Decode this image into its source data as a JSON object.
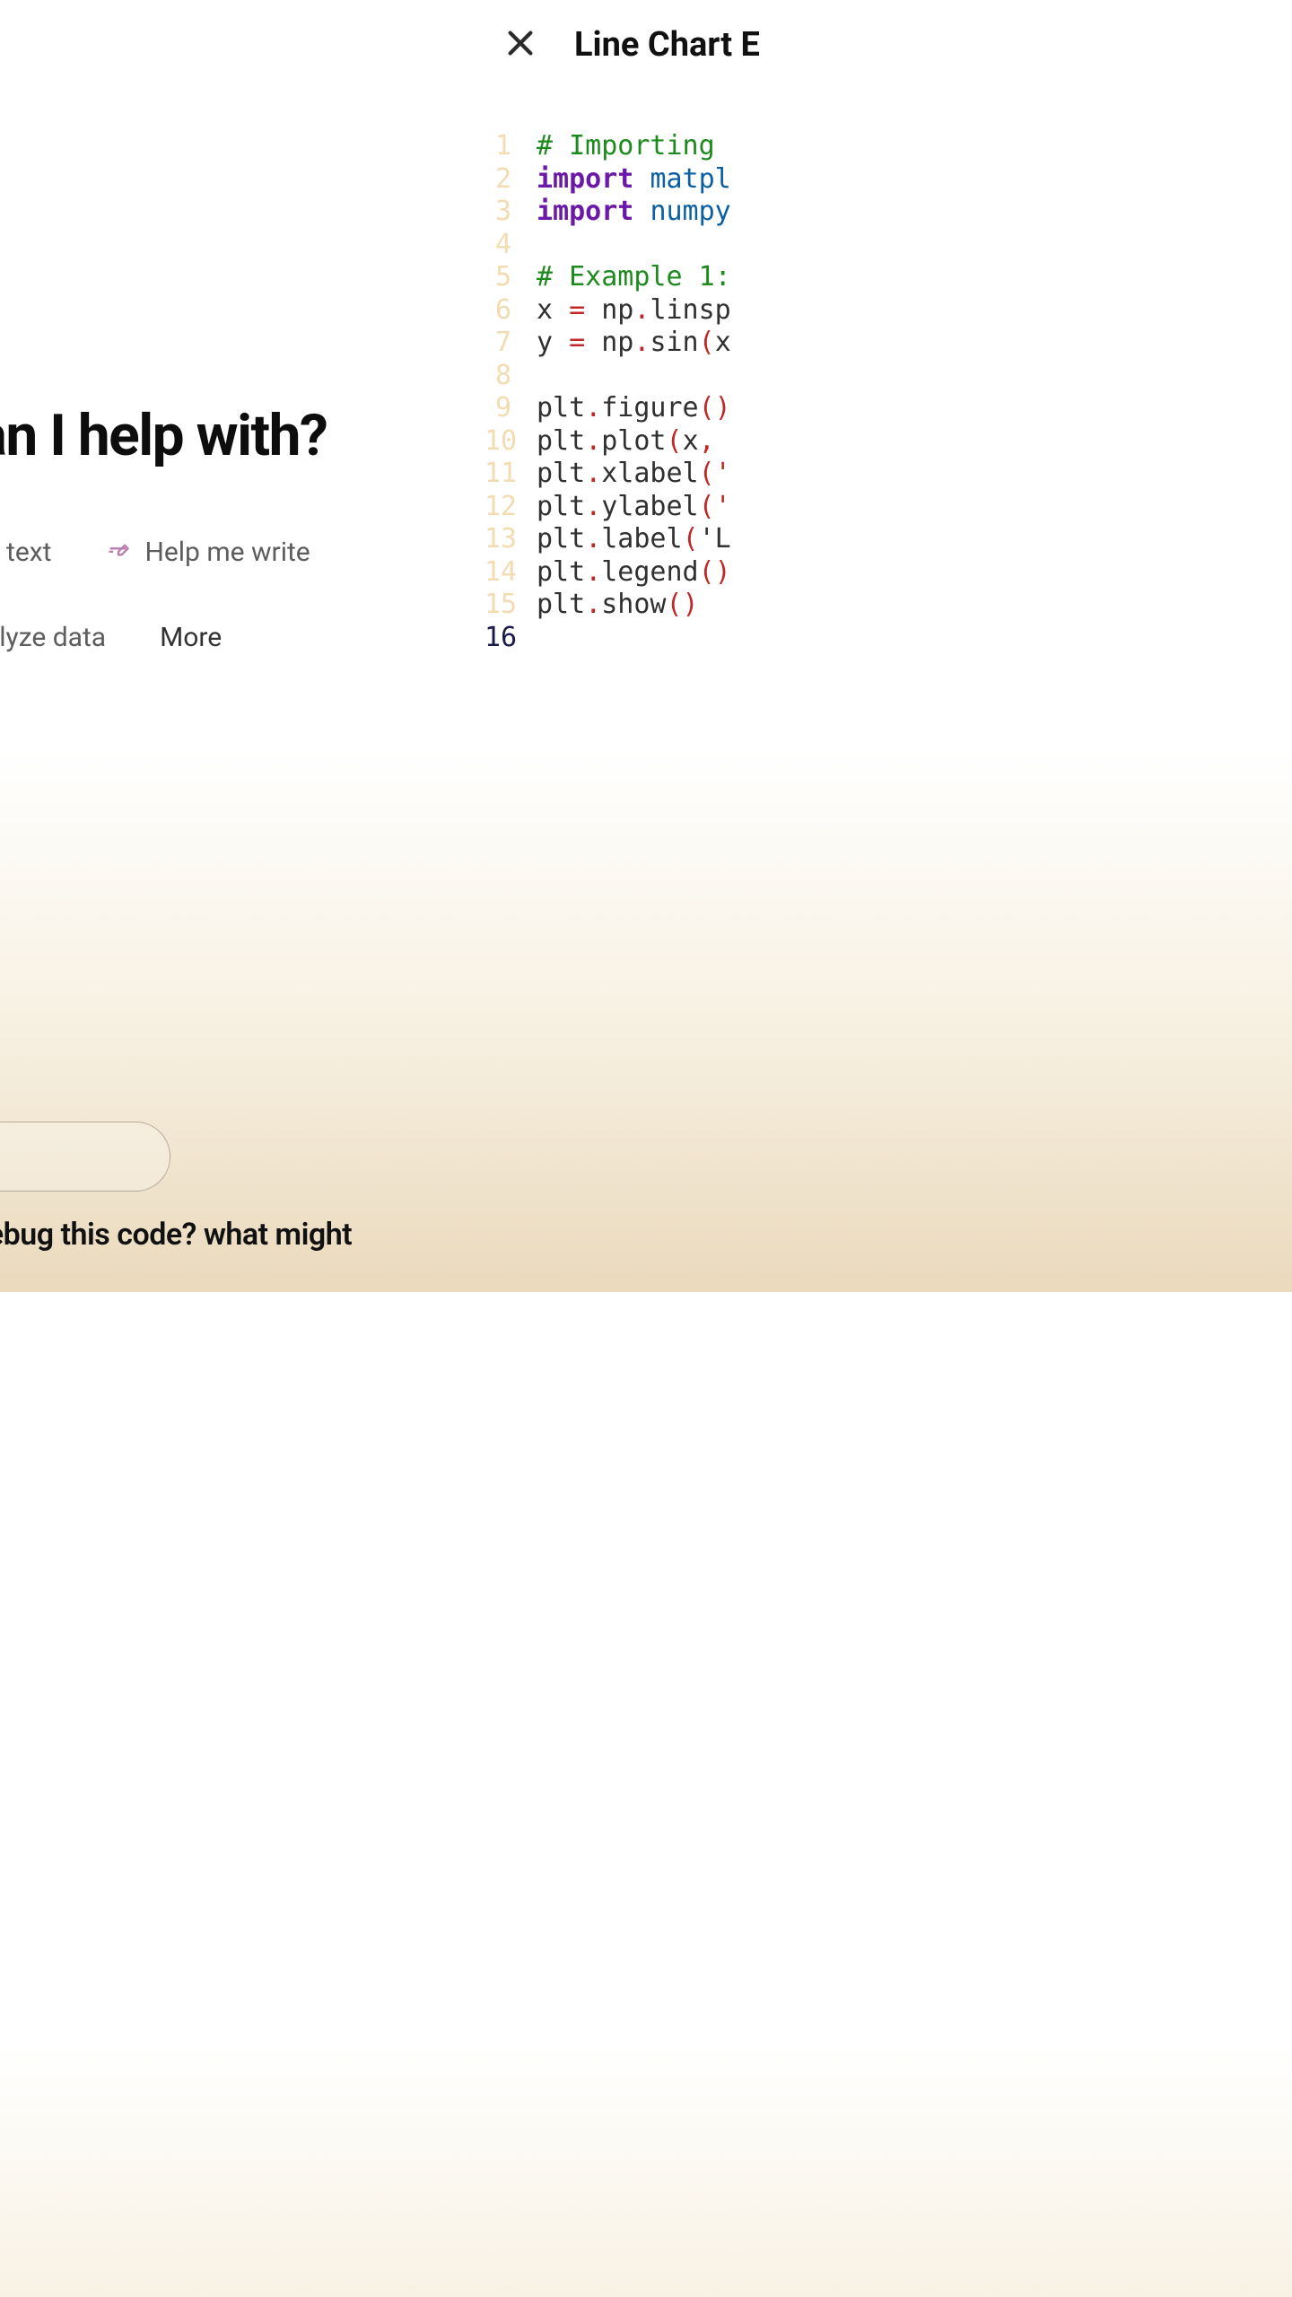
{
  "left": {
    "headline": "What can I help with?",
    "chips1": [
      {
        "id": "summarize",
        "label": "Summarize text"
      },
      {
        "id": "write",
        "label": "Help me write"
      }
    ],
    "chips2": [
      {
        "id": "analyze",
        "label": "Analyze data"
      },
      {
        "id": "more",
        "label": "More"
      }
    ],
    "partial_prompt": "Can you debug this code? what might"
  },
  "panel": {
    "title": "Line Chart E",
    "close_glyph": "×",
    "lines": [
      {
        "n": "1",
        "tokens": [
          [
            "cm",
            "# Importing "
          ]
        ]
      },
      {
        "n": "2",
        "tokens": [
          [
            "kw",
            "import"
          ],
          [
            "",
            " "
          ],
          [
            "mod",
            "matpl"
          ]
        ]
      },
      {
        "n": "3",
        "tokens": [
          [
            "kw",
            "import"
          ],
          [
            "",
            " "
          ],
          [
            "mod",
            "numpy"
          ]
        ]
      },
      {
        "n": "4",
        "tokens": []
      },
      {
        "n": "5",
        "tokens": [
          [
            "cm",
            "# Example 1:"
          ]
        ]
      },
      {
        "n": "6",
        "tokens": [
          [
            "var",
            "x "
          ],
          [
            "op",
            "="
          ],
          [
            "",
            " np"
          ],
          [
            "op",
            "."
          ],
          [
            "fn",
            "linsp"
          ]
        ]
      },
      {
        "n": "7",
        "tokens": [
          [
            "var",
            "y "
          ],
          [
            "op",
            "="
          ],
          [
            "",
            " np"
          ],
          [
            "op",
            "."
          ],
          [
            "fn",
            "sin"
          ],
          [
            "op",
            "("
          ],
          [
            "var",
            "x"
          ]
        ]
      },
      {
        "n": "8",
        "tokens": []
      },
      {
        "n": "9",
        "tokens": [
          [
            "var",
            "plt"
          ],
          [
            "op",
            "."
          ],
          [
            "fn",
            "figure"
          ],
          [
            "op",
            "()"
          ]
        ]
      },
      {
        "n": "10",
        "tokens": [
          [
            "var",
            "plt"
          ],
          [
            "op",
            "."
          ],
          [
            "fn",
            "plot"
          ],
          [
            "op",
            "("
          ],
          [
            "var",
            "x"
          ],
          [
            "op",
            ", "
          ]
        ]
      },
      {
        "n": "11",
        "tokens": [
          [
            "var",
            "plt"
          ],
          [
            "op",
            "."
          ],
          [
            "fn",
            "xlabel"
          ],
          [
            "op",
            "('"
          ]
        ]
      },
      {
        "n": "12",
        "tokens": [
          [
            "var",
            "plt"
          ],
          [
            "op",
            "."
          ],
          [
            "fn",
            "ylabel"
          ],
          [
            "op",
            "('"
          ]
        ]
      },
      {
        "n": "13",
        "tokens": [
          [
            "var",
            "plt"
          ],
          [
            "op",
            "."
          ],
          [
            "fn",
            "label"
          ],
          [
            "op",
            "("
          ],
          [
            "str",
            "'L"
          ]
        ]
      },
      {
        "n": "14",
        "tokens": [
          [
            "var",
            "plt"
          ],
          [
            "op",
            "."
          ],
          [
            "fn",
            "legend"
          ],
          [
            "op",
            "()"
          ]
        ]
      },
      {
        "n": "15",
        "tokens": [
          [
            "var",
            "plt"
          ],
          [
            "op",
            "."
          ],
          [
            "fn",
            "show"
          ],
          [
            "op",
            "()"
          ]
        ]
      },
      {
        "n": "16",
        "tokens": [],
        "current": true
      }
    ]
  }
}
